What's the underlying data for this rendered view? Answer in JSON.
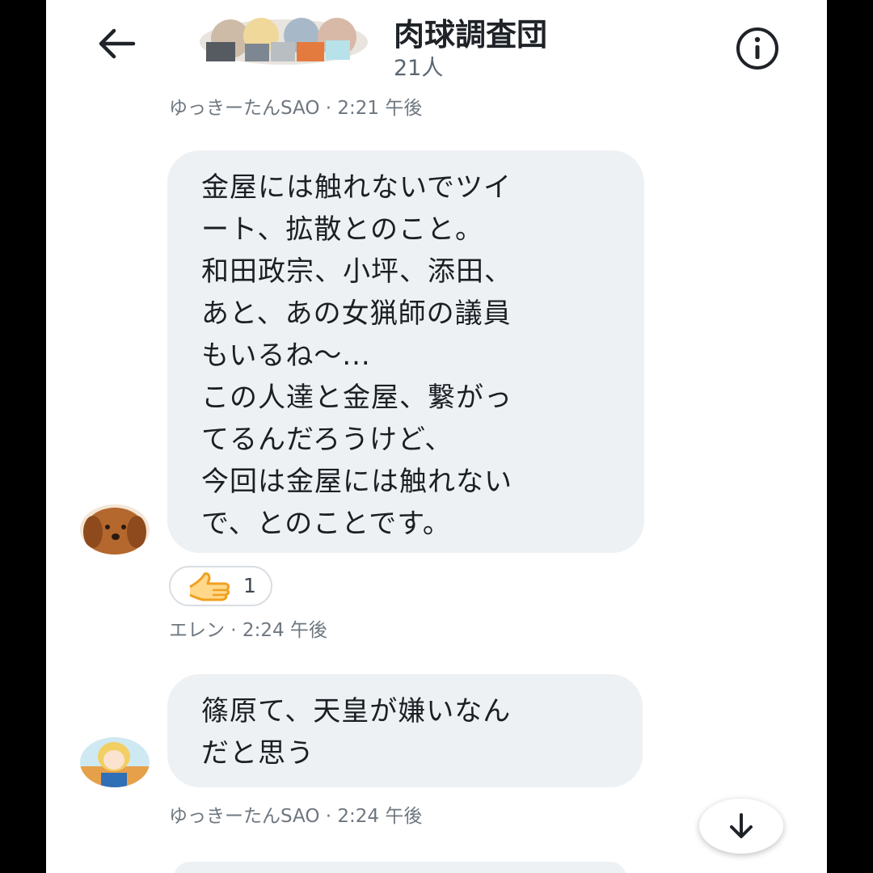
{
  "header": {
    "title": "肉球調査団",
    "member_count": "21人"
  },
  "messages": [
    {
      "sender_meta": "ゆっきーたんSAO · 2:21 午後",
      "lines": [
        "金屋には触れないでツイ",
        "ート、拡散とのこと。",
        "和田政宗、小坪、添田、",
        "あと、あの女猟師の議員",
        "もいるね～...",
        "この人達と金屋、繋がっ",
        "てるんだろうけど、",
        "今回は金屋には触れない",
        "で、とのことです。"
      ],
      "reaction": {
        "icon": "thumbs-up-icon",
        "count": "1"
      }
    },
    {
      "sender_meta": "エレン · 2:24 午後",
      "lines": [
        "篠原て、天皇が嫌いなん",
        "だと思う"
      ]
    }
  ],
  "footer_meta": "ゆっきーたんSAO · 2:24 午後",
  "colors": {
    "bubble": "#eef1f4",
    "accent_reaction": "#f0a020",
    "text": "#1b1f23",
    "meta": "#6e7780"
  }
}
